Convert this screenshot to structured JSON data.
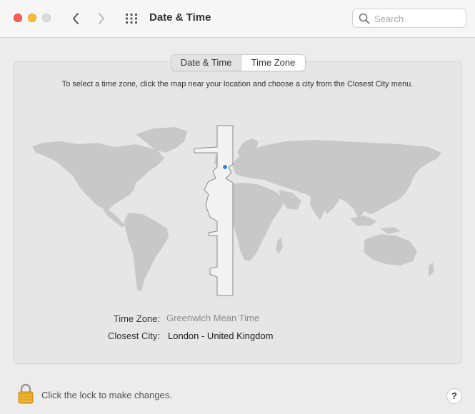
{
  "window": {
    "title": "Date & Time",
    "controls": {
      "close": "close-button",
      "minimize": "minimize-button",
      "zoom": "zoom-button"
    }
  },
  "toolbar": {
    "back_icon": "chevron-left-icon",
    "forward_icon": "chevron-right-icon",
    "grid_icon": "show-all-grid-icon",
    "search_placeholder": "Search",
    "search_value": ""
  },
  "tabs": [
    {
      "label": "Date & Time",
      "selected": false
    },
    {
      "label": "Time Zone",
      "selected": true
    }
  ],
  "timezone": {
    "instructions": "To select a time zone, click the map near your location and choose a city from the Closest City menu.",
    "time_zone_label": "Time Zone:",
    "time_zone_value": "Greenwich Mean Time",
    "closest_city_label": "Closest City:",
    "closest_city_value": "London - United Kingdom"
  },
  "footer": {
    "lock_text": "Click the lock to make changes.",
    "help_label": "?"
  },
  "colors": {
    "accent": "#2f7cf6",
    "map_land": "#c8c8c8",
    "highlight_zone": "#f2f2f2"
  }
}
